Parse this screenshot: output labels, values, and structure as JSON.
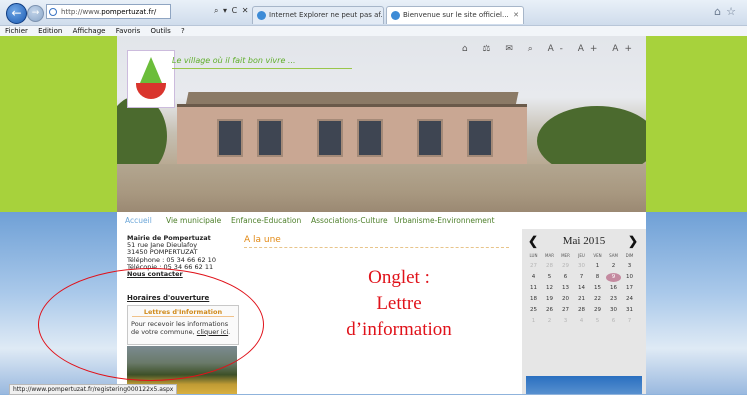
{
  "browser": {
    "address": {
      "prefix": "http://www.",
      "domain": "pompertuzat.fr/"
    },
    "address_controls": "⌕ ▾ C ✕",
    "tabs": [
      {
        "label": "Internet Explorer ne peut pas af...",
        "active": false
      },
      {
        "label": "Bienvenue sur le site officiel...",
        "active": true
      }
    ],
    "menu": [
      "Fichier",
      "Edition",
      "Affichage",
      "Favoris",
      "Outils",
      "?"
    ],
    "status_url": "http://www.pompertuzat.fr/registering000122x5.aspx"
  },
  "header": {
    "slogan": "Le village où il fait bon vivre ...",
    "tools": "⌂ ⚖ ✉ ⌕ A- A+ A+"
  },
  "nav": {
    "items": [
      "Accueil",
      "Vie municipale",
      "Enfance-Education",
      "Associations-Culture",
      "Urbanisme-Environnement"
    ]
  },
  "sidebar": {
    "mairie": [
      "Mairie de Pompertuzat",
      "51 rue Jane Dieulafoy",
      "31450 POMPERTUZAT"
    ],
    "phone": "Téléphone : 05 34 66 62 10",
    "fax": "Télécopie : 05 34 66 62 11",
    "contact": "Nous contacter",
    "horaires": "Horaires d'ouverture",
    "lettre": {
      "title": "Lettres d'Information",
      "text": "Pour recevoir les informations de votre commune,",
      "link": "cliquer ici"
    }
  },
  "main": {
    "heading": "A la une",
    "annotation": [
      "Onglet :",
      "Lettre",
      "d’information"
    ]
  },
  "calendar": {
    "month": "Mai 2015",
    "day_names": [
      "LUN",
      "MAR",
      "MER",
      "JEU",
      "VEN",
      "SAM",
      "DIM"
    ],
    "weeks": [
      [
        "27",
        "28",
        "29",
        "30",
        "1",
        "2",
        "3"
      ],
      [
        "4",
        "5",
        "6",
        "7",
        "8",
        "9",
        "10"
      ],
      [
        "11",
        "12",
        "13",
        "14",
        "15",
        "16",
        "17"
      ],
      [
        "18",
        "19",
        "20",
        "21",
        "22",
        "23",
        "24"
      ],
      [
        "25",
        "26",
        "27",
        "28",
        "29",
        "30",
        "31"
      ],
      [
        "1",
        "2",
        "3",
        "4",
        "5",
        "6",
        "7"
      ]
    ],
    "today": "9",
    "colors": {
      "today": "#c48aa0",
      "annotation": "#e0121a",
      "nav": "#4d7f2a"
    }
  }
}
